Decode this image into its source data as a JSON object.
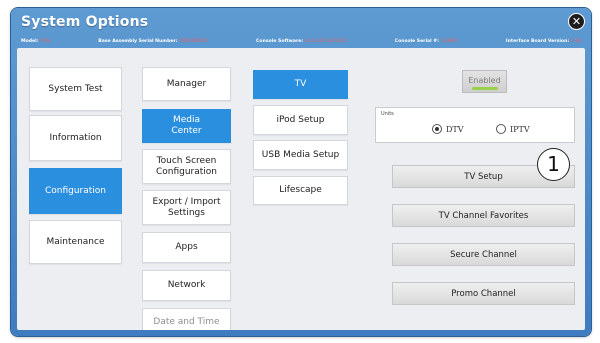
{
  "window": {
    "title": "System Options",
    "close_glyph": "✕"
  },
  "info_bar": {
    "model_label": "Model:",
    "model_value": "91fe",
    "base_serial_label": "Base Assembly Serial Number:",
    "base_serial_value": "TE01000011",
    "console_software_label": "Console Software:",
    "console_software_value": "v2.12.02.1201211",
    "console_serial_label": "Console Serial #:",
    "console_serial_value": "123987",
    "interface_board_label": "Interface Board Version:",
    "interface_board_value": "0.18"
  },
  "left_nav": [
    {
      "label": "System Test",
      "active": false
    },
    {
      "label": "Information",
      "active": false
    },
    {
      "label": "Configuration",
      "active": true
    },
    {
      "label": "Maintenance",
      "active": false
    }
  ],
  "config_menu": [
    {
      "label": "Manager",
      "active": false
    },
    {
      "label": "Media\nCenter",
      "active": true
    },
    {
      "label": "Touch Screen\nConfiguration",
      "active": false
    },
    {
      "label": "Export / Import\nSettings",
      "active": false
    },
    {
      "label": "Apps",
      "active": false
    },
    {
      "label": "Network",
      "active": false
    },
    {
      "label": "Date and Time",
      "active": false
    }
  ],
  "media_menu": [
    {
      "label": "TV",
      "active": true
    },
    {
      "label": "iPod Setup",
      "active": false
    },
    {
      "label": "USB Media Setup",
      "active": false
    },
    {
      "label": "Lifescape",
      "active": false
    }
  ],
  "tv_settings": {
    "enabled_label": "Enabled",
    "units_label": "Units",
    "units_options": [
      "DTV",
      "IPTV"
    ],
    "units_selected": "DTV",
    "actions": [
      "TV Setup",
      "TV Channel Favorites",
      "Secure Channel",
      "Promo Channel"
    ]
  },
  "callout": {
    "label": "1"
  },
  "colors": {
    "active_blue": "#2b8fe0",
    "title_bar": "#4f8bc9",
    "enabled_indicator": "#9ad04a",
    "info_value_red": "#f05a5a"
  }
}
